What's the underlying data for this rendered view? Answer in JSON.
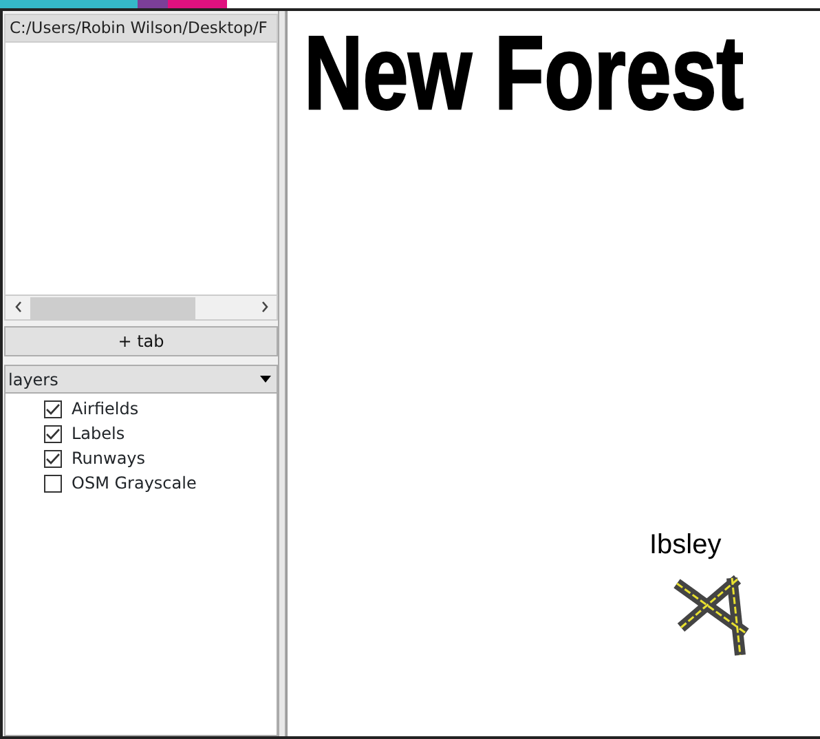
{
  "path_field": {
    "value": "C:/Users/Robin Wilson/Desktop/F"
  },
  "add_tab_button": {
    "label": "+ tab"
  },
  "layer_dropdown": {
    "value": "layers"
  },
  "layers": [
    {
      "label": "Airfields",
      "checked": true
    },
    {
      "label": "Labels",
      "checked": true
    },
    {
      "label": "Runways",
      "checked": true
    },
    {
      "label": "OSM Grayscale",
      "checked": false
    }
  ],
  "map": {
    "title": "New Forest",
    "features": [
      {
        "kind": "airfield",
        "label": "Ibsley"
      }
    ]
  }
}
